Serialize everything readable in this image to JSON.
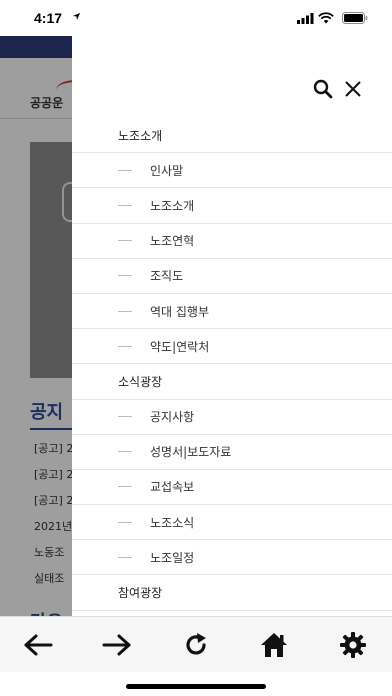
{
  "status_bar": {
    "time": "4:17"
  },
  "background": {
    "logo_text": "공공운",
    "notice_title": "공지",
    "notices": [
      "[공고] 2",
      "[공고] 2",
      "[공고] 2",
      "2021년",
      "노동조",
      "실태조"
    ],
    "next_section_title": "라오"
  },
  "drawer": {
    "menu": [
      {
        "type": "section",
        "label": "노조소개"
      },
      {
        "type": "item",
        "label": "인사말"
      },
      {
        "type": "item",
        "label": "노조소개"
      },
      {
        "type": "item",
        "label": "노조연혁"
      },
      {
        "type": "item",
        "label": "조직도"
      },
      {
        "type": "item",
        "label": "역대 집행부"
      },
      {
        "type": "item",
        "label": "약도|연락처"
      },
      {
        "type": "section",
        "label": "소식광장"
      },
      {
        "type": "item",
        "label": "공지사항"
      },
      {
        "type": "item",
        "label": "성명서|보도자료"
      },
      {
        "type": "item",
        "label": "교섭속보"
      },
      {
        "type": "item",
        "label": "노조소식"
      },
      {
        "type": "item",
        "label": "노조일정"
      },
      {
        "type": "section",
        "label": "참여광장"
      }
    ]
  },
  "toolbar": {
    "buttons": [
      {
        "icon": "back-arrow-icon"
      },
      {
        "icon": "forward-arrow-icon"
      },
      {
        "icon": "reload-icon"
      },
      {
        "icon": "home-icon"
      },
      {
        "icon": "settings-gear-icon"
      }
    ]
  },
  "colors": {
    "brand_navy": "#2f3d7e",
    "notice_blue": "#2f4a9b",
    "overlay": "rgba(0,0,0,0.38)"
  }
}
